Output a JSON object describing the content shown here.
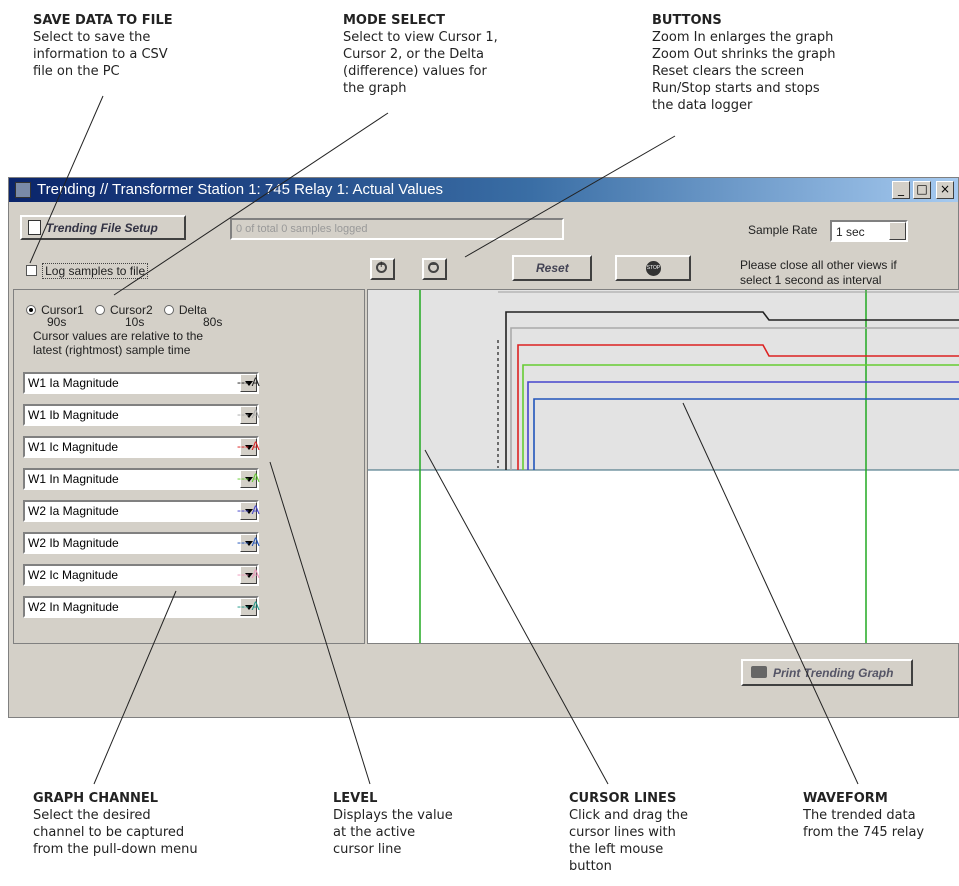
{
  "callouts": {
    "save": {
      "title": "SAVE DATA TO FILE",
      "body": "Select to save the\ninformation to a CSV\nfile on the PC"
    },
    "mode": {
      "title": "MODE SELECT",
      "body": "Select to view Cursor 1,\nCursor 2, or the Delta\n(difference) values for\nthe graph"
    },
    "buttons": {
      "title": "BUTTONS",
      "body": "Zoom In enlarges the graph\nZoom Out shrinks the graph\nReset clears the screen\nRun/Stop starts and stops\nthe data logger"
    },
    "channel": {
      "title": "GRAPH CHANNEL",
      "body": "Select the desired\nchannel to be captured\nfrom the pull-down menu"
    },
    "level": {
      "title": "LEVEL",
      "body": "Displays the value\nat the active\ncursor line"
    },
    "cursor": {
      "title": "CURSOR LINES",
      "body": "Click and drag the\ncursor lines with\nthe left mouse\nbutton"
    },
    "waveform": {
      "title": "WAVEFORM",
      "body": "The trended data\nfrom the 745 relay"
    }
  },
  "window": {
    "title": "Trending // Transformer Station 1: 745 Relay 1: Actual Values",
    "min": "_",
    "max": "□",
    "close": "×"
  },
  "toolbar": {
    "setup_label": "Trending File Setup",
    "samples_logged": "0 of total 0 samples logged",
    "log_to_file": "Log samples to file",
    "zoom_in": "+",
    "zoom_out": "−",
    "reset": "Reset",
    "stop": "STOP",
    "sample_rate_label": "Sample Rate",
    "sample_rate_value": "1 sec",
    "note1": "Please close all other views if",
    "note2": "select 1 second as interval"
  },
  "cursor_panel": {
    "options": [
      "Cursor1",
      "Cursor2",
      "Delta"
    ],
    "selected": "Cursor1",
    "values": [
      "90s",
      "10s",
      "80s"
    ],
    "note1": "Cursor values are relative to the",
    "note2": "latest (rightmost) sample time"
  },
  "channels": [
    {
      "label": "W1 Ia Magnitude",
      "level": "--- A",
      "color": "#222222"
    },
    {
      "label": "W1 Ib Magnitude",
      "level": "--- A",
      "color": "#aaaaaa"
    },
    {
      "label": "W1 Ic Magnitude",
      "level": "--- A",
      "color": "#dd2222"
    },
    {
      "label": "W1 In Magnitude",
      "level": "--- A",
      "color": "#66cc33"
    },
    {
      "label": "W2 Ia Magnitude",
      "level": "--- A",
      "color": "#4444cc"
    },
    {
      "label": "W2 Ib Magnitude",
      "level": "--- A",
      "color": "#2255bb"
    },
    {
      "label": "W2 Ic Magnitude",
      "level": "--- A",
      "color": "#ee99bb"
    },
    {
      "label": "W2 In Magnitude",
      "level": "--- A",
      "color": "#22998a"
    }
  ],
  "print_label": "Print Trending Graph",
  "colors": {
    "cursor1": "#22aa22",
    "cursor2": "#22aa22",
    "midline": "#336677"
  }
}
